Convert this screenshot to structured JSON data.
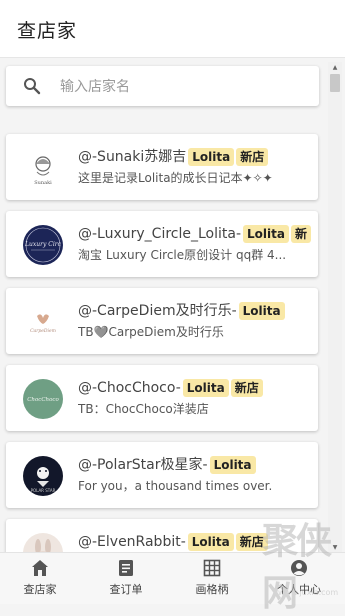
{
  "header": {
    "title": "查店家"
  },
  "search": {
    "placeholder": "输入店家名",
    "value": ""
  },
  "badge_colors": {
    "badge_bg": "#f9e8a6"
  },
  "shops": [
    {
      "name": "@-Sunaki苏娜吉",
      "badges": [
        "Lolita",
        "新店"
      ],
      "desc": "这里是记录Lolita的成长日记本✦✧✦",
      "avatar": "sunaki-logo"
    },
    {
      "name": "@-Luxury_Circle_Lolita-",
      "badges": [
        "Lolita",
        "新"
      ],
      "desc": "淘宝 Luxury Circle原创设计 qq群 4...",
      "avatar": "luxury-circle-logo"
    },
    {
      "name": "@-CarpeDiem及时行乐-",
      "badges": [
        "Lolita"
      ],
      "desc": "TB🩶CarpeDiem及时行乐",
      "avatar": "carpediem-logo"
    },
    {
      "name": "@-ChocChoco-",
      "badges": [
        "Lolita",
        "新店"
      ],
      "desc": "TB：ChocChoco洋装店",
      "avatar": "chocchoco-logo"
    },
    {
      "name": "@-PolarStar极星家-",
      "badges": [
        "Lolita"
      ],
      "desc": "For you，a thousand times over.",
      "avatar": "polarstar-logo"
    },
    {
      "name": "@-ElvenRabbit-",
      "badges": [
        "Lolita",
        "新店"
      ],
      "desc": "",
      "avatar": "elvenrabbit-logo"
    }
  ],
  "nav": [
    {
      "label": "查店家",
      "icon": "home-icon"
    },
    {
      "label": "查订单",
      "icon": "order-icon"
    },
    {
      "label": "画格柄",
      "icon": "grid-icon"
    },
    {
      "label": "个人中心",
      "icon": "profile-icon"
    }
  ],
  "watermark": {
    "text": "聚侠网",
    "url": "www.juxia.com"
  }
}
